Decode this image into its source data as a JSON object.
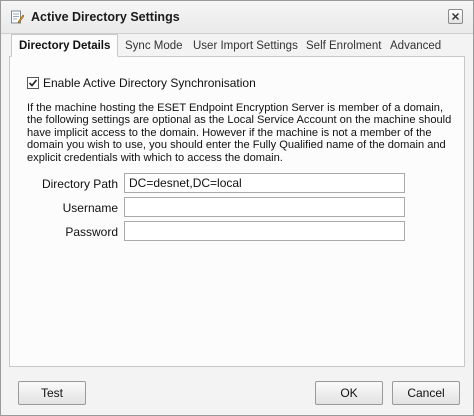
{
  "window": {
    "title": "Active Directory Settings"
  },
  "tabs": [
    {
      "label": "Directory Details",
      "active": true
    },
    {
      "label": "Sync Mode",
      "active": false
    },
    {
      "label": "User Import Settings",
      "active": false
    },
    {
      "label": "Self Enrolment",
      "active": false
    },
    {
      "label": "Advanced",
      "active": false
    }
  ],
  "directory_details": {
    "sync_checkbox": {
      "label": "Enable Active Directory Synchronisation",
      "checked": true
    },
    "description": "If the machine hosting the ESET Endpoint Encryption Server is member of a domain, the following settings are optional as the Local Service Account on the machine should have implicit access to the domain. However if the machine is not a member of the domain you wish to use, you should enter the Fully Qualified name of the domain and explicit credentials with which to access the domain.",
    "fields": {
      "directory_path": {
        "label": "Directory Path",
        "value": "DC=desnet,DC=local"
      },
      "username": {
        "label": "Username",
        "value": ""
      },
      "password": {
        "label": "Password",
        "value": ""
      }
    }
  },
  "buttons": {
    "test": "Test",
    "ok": "OK",
    "cancel": "Cancel"
  },
  "icons": {
    "title": "settings-document-icon",
    "close": "close-icon",
    "checkmark": "checkmark-icon"
  }
}
